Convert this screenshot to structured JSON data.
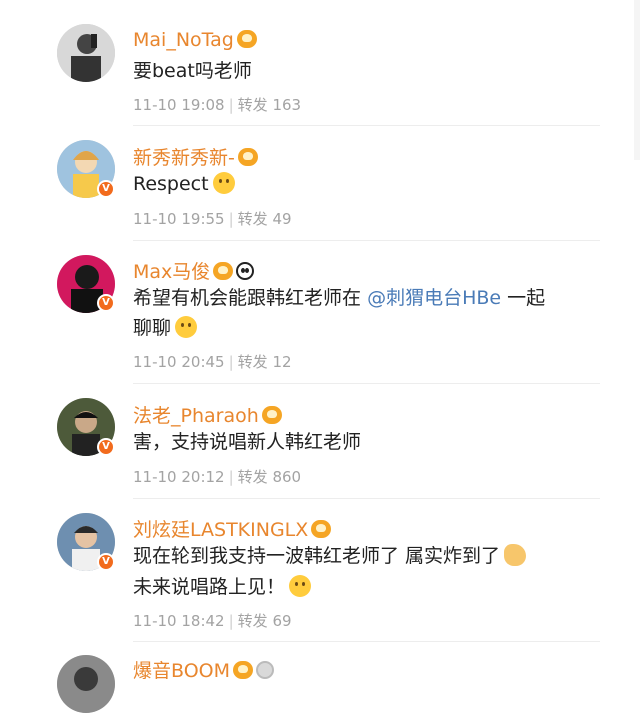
{
  "comments": [
    {
      "username": "Mai_NoTag",
      "text": "要beat吗老师",
      "time": "11-10 19:08",
      "repost_label": "转发",
      "repost_count": "163",
      "verified": false
    },
    {
      "username": "新秀新秀新-",
      "text": "Respect",
      "time": "11-10 19:55",
      "repost_label": "转发",
      "repost_count": "49",
      "verified": true
    },
    {
      "username": "Max马俊",
      "text_before": "希望有机会能跟韩红老师在",
      "mention": "@刺猬电台HBe",
      "text_after": "一起",
      "text_line2": "聊聊",
      "time": "11-10 20:45",
      "repost_label": "转发",
      "repost_count": "12",
      "verified": true
    },
    {
      "username": "法老_Pharaoh",
      "text": "害，支持说唱新人韩红老师",
      "time": "11-10 20:12",
      "repost_label": "转发",
      "repost_count": "860",
      "verified": true
    },
    {
      "username": "刘炫廷LASTKINGLX",
      "text": "现在轮到我支持一波韩红老师了 属实炸到了",
      "text_line2": "未来说唱路上见！",
      "time": "11-10 18:42",
      "repost_label": "转发",
      "repost_count": "69",
      "verified": true
    },
    {
      "username": "爆音BOOM",
      "verified": false
    }
  ],
  "colors": {
    "username": "#e8862e",
    "mention": "#4a7bb7",
    "meta": "#a3a3a3",
    "verified_badge": "#f26b1d"
  },
  "icons": [
    "level-badge-icon",
    "panda-emoji-icon",
    "medal-icon",
    "verified-icon",
    "emoji-icon"
  ]
}
